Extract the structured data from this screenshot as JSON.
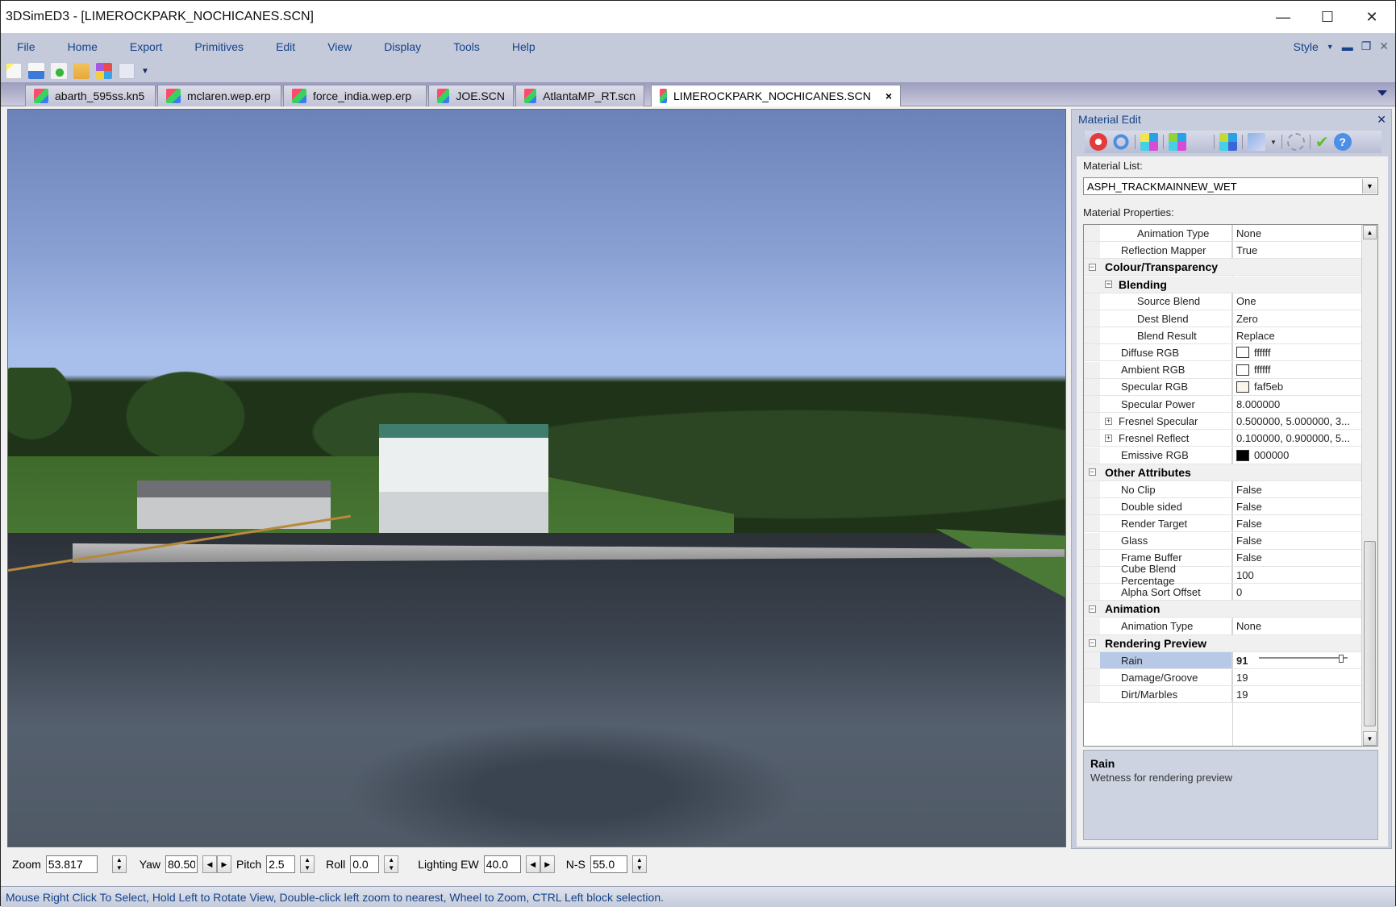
{
  "window": {
    "title": "3DSimED3 - [LIMEROCKPARK_NOCHICANES.SCN]",
    "controls": {
      "minimize_icon": "minimize-icon",
      "maximize_icon": "maximize-icon",
      "close_icon": "close-icon"
    }
  },
  "menu": {
    "items": [
      "File",
      "Home",
      "Export",
      "Primitives",
      "Edit",
      "View",
      "Display",
      "Tools",
      "Help"
    ],
    "style_label": "Style"
  },
  "quick_access": {
    "icons": [
      "new-file-icon",
      "import-icon",
      "export-icon",
      "open-folder-icon",
      "palette-icon",
      "copy-icon",
      "customize-dropdown-icon"
    ]
  },
  "tabs": [
    {
      "label": "abarth_595ss.kn5",
      "active": false
    },
    {
      "label": "mclaren.wep.erp",
      "active": false
    },
    {
      "label": "force_india.wep.erp",
      "active": false
    },
    {
      "label": "JOE.SCN",
      "active": false
    },
    {
      "label": "AtlantaMP_RT.scn",
      "active": false
    },
    {
      "label": "LIMEROCKPARK_NOCHICANES.SCN",
      "active": true
    }
  ],
  "tab_close_glyph": "×",
  "controls": {
    "zoom_label": "Zoom",
    "zoom_value": "53.817",
    "yaw_label": "Yaw",
    "yaw_value": "80.500",
    "pitch_label": "Pitch",
    "pitch_value": "2.5",
    "roll_label": "Roll",
    "roll_value": "0.0",
    "lighting_ew_label": "Lighting EW",
    "lighting_ew_value": "40.0",
    "ns_label": "N-S",
    "ns_value": "55.0"
  },
  "status_text": "Mouse Right Click To Select, Hold Left to Rotate View, Double-click left  zoom to nearest, Wheel to Zoom, CTRL Left block selection.",
  "panel": {
    "title": "Material Edit",
    "toolbar_icons": [
      "delete-icon",
      "undo-icon",
      "new-material-icon",
      "copy-material-icon",
      "paste-material-icon",
      "material-info-icon",
      "edit-texture-icon",
      "select-circle-icon",
      "apply-check-icon",
      "help-icon"
    ],
    "material_list_label": "Material List:",
    "material_selected": "ASPH_TRACKMAINNEW_WET",
    "properties_label": "Material Properties:",
    "rows": [
      {
        "type": "prop",
        "name": "Animation Type",
        "value": "None",
        "indent": 2
      },
      {
        "type": "prop",
        "name": "Reflection Mapper",
        "value": "True",
        "indent": 1
      },
      {
        "type": "cat",
        "name": "Colour/Transparency",
        "indent": 0
      },
      {
        "type": "cat",
        "name": "Blending",
        "indent": 1
      },
      {
        "type": "prop",
        "name": "Source Blend",
        "value": "One",
        "indent": 2
      },
      {
        "type": "prop",
        "name": "Dest Blend",
        "value": "Zero",
        "indent": 2
      },
      {
        "type": "prop",
        "name": "Blend Result",
        "value": "Replace",
        "indent": 2
      },
      {
        "type": "prop",
        "name": "Diffuse RGB",
        "value": "ffffff",
        "swatch": "#ffffff",
        "indent": 1
      },
      {
        "type": "prop",
        "name": "Ambient RGB",
        "value": "ffffff",
        "swatch": "#ffffff",
        "indent": 1
      },
      {
        "type": "prop",
        "name": "Specular RGB",
        "value": "faf5eb",
        "swatch": "#faf5eb",
        "indent": 1
      },
      {
        "type": "prop",
        "name": "Specular Power",
        "value": "8.000000",
        "indent": 1
      },
      {
        "type": "prop",
        "name": "Fresnel Specular",
        "value": "0.500000, 5.000000, 3...",
        "expandable": true,
        "indent": 1
      },
      {
        "type": "prop",
        "name": "Fresnel Reflect",
        "value": "0.100000, 0.900000, 5...",
        "expandable": true,
        "indent": 1
      },
      {
        "type": "prop",
        "name": "Emissive RGB",
        "value": "000000",
        "swatch": "#000000",
        "indent": 1
      },
      {
        "type": "cat",
        "name": "Other Attributes",
        "indent": 0
      },
      {
        "type": "prop",
        "name": "No Clip",
        "value": "False",
        "indent": 1
      },
      {
        "type": "prop",
        "name": "Double sided",
        "value": "False",
        "indent": 1
      },
      {
        "type": "prop",
        "name": "Render Target",
        "value": "False",
        "indent": 1
      },
      {
        "type": "prop",
        "name": "Glass",
        "value": "False",
        "indent": 1
      },
      {
        "type": "prop",
        "name": "Frame Buffer",
        "value": "False",
        "indent": 1
      },
      {
        "type": "prop",
        "name": "Cube Blend Percentage",
        "value": "100",
        "indent": 1
      },
      {
        "type": "prop",
        "name": "Alpha Sort Offset",
        "value": "0",
        "indent": 1
      },
      {
        "type": "cat",
        "name": "Animation",
        "indent": 0
      },
      {
        "type": "prop",
        "name": "Animation Type",
        "value": "None",
        "indent": 1
      },
      {
        "type": "cat",
        "name": "Rendering Preview",
        "indent": 0
      },
      {
        "type": "prop",
        "name": "Rain",
        "value": "91",
        "slider_fraction": 0.91,
        "selected": true,
        "indent": 1
      },
      {
        "type": "prop",
        "name": "Damage/Groove",
        "value": "19",
        "indent": 1
      },
      {
        "type": "prop",
        "name": "Dirt/Marbles",
        "value": "19",
        "indent": 1
      }
    ],
    "help_title": "Rain",
    "help_description": "Wetness for rendering preview"
  }
}
